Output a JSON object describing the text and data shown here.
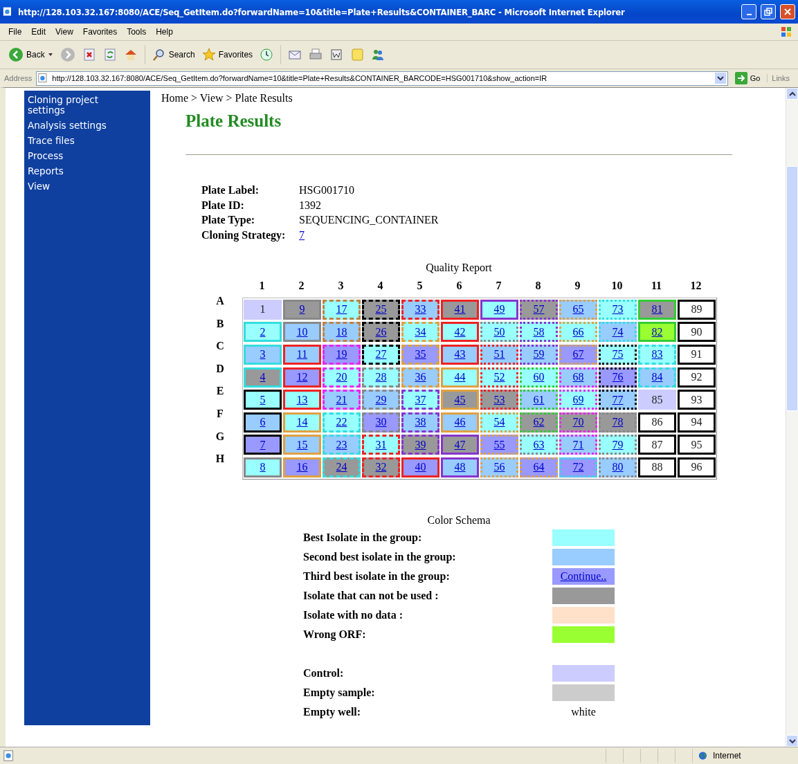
{
  "window": {
    "title": "http://128.103.32.167:8080/ACE/Seq_GetItem.do?forwardName=10&title=Plate+Results&CONTAINER_BARC - Microsoft Internet Explorer"
  },
  "menu": [
    "File",
    "Edit",
    "View",
    "Favorites",
    "Tools",
    "Help"
  ],
  "toolbar": {
    "back": "Back",
    "search": "Search",
    "favorites": "Favorites"
  },
  "address": {
    "label": "Address",
    "value": "http://128.103.32.167:8080/ACE/Seq_GetItem.do?forwardName=10&title=Plate+Results&CONTAINER_BARCODE=HSG001710&show_action=IR",
    "go": "Go",
    "links": "Links"
  },
  "sidebar": {
    "items": [
      "Cloning project settings",
      "Analysis settings",
      "Trace files",
      "Process",
      "Reports",
      "View"
    ]
  },
  "breadcrumb": "Home > View > Plate Results",
  "title": "Plate Results",
  "info": [
    {
      "label": "Plate Label:",
      "value": "HSG001710",
      "link": false
    },
    {
      "label": "Plate ID:",
      "value": "1392",
      "link": false
    },
    {
      "label": "Plate Type:",
      "value": "SEQUENCING_CONTAINER",
      "link": false
    },
    {
      "label": "Cloning Strategy:",
      "value": "7",
      "link": true
    }
  ],
  "plate": {
    "title": "Quality Report",
    "columns": [
      "1",
      "2",
      "3",
      "4",
      "5",
      "6",
      "7",
      "8",
      "9",
      "10",
      "11",
      "12"
    ],
    "rows": [
      {
        "label": "A",
        "wells": [
          {
            "label": "1",
            "link": false,
            "color": "#ccccff"
          },
          {
            "label": "9",
            "link": true,
            "color": "#999999",
            "frame": {
              "kind": "solid",
              "color": "#888888"
            }
          },
          {
            "label": "17",
            "link": true,
            "color": "#99ffff",
            "frame": {
              "kind": "dashed",
              "color": "#c08040"
            }
          },
          {
            "label": "25",
            "link": true,
            "color": "#999999",
            "frame": {
              "kind": "dashed",
              "color": "#000000"
            }
          },
          {
            "label": "33",
            "link": true,
            "color": "#99ccff",
            "frame": {
              "kind": "dashed",
              "color": "#ee2222"
            }
          },
          {
            "label": "41",
            "link": true,
            "color": "#999999",
            "frame": {
              "kind": "solid",
              "color": "#ee2222"
            }
          },
          {
            "label": "49",
            "link": true,
            "color": "#99ffff",
            "frame": {
              "kind": "solid",
              "color": "#8833cc"
            }
          },
          {
            "label": "57",
            "link": true,
            "color": "#999999",
            "frame": {
              "kind": "dotted",
              "color": "#8833cc"
            }
          },
          {
            "label": "65",
            "link": true,
            "color": "#99ccff",
            "frame": {
              "kind": "dotted",
              "color": "#e0a040"
            }
          },
          {
            "label": "73",
            "link": true,
            "color": "#99ffff",
            "frame": {
              "kind": "dotted",
              "color": "#33dddd"
            }
          },
          {
            "label": "81",
            "link": true,
            "color": "#999999",
            "frame": {
              "kind": "solid",
              "color": "#33cc33"
            }
          },
          {
            "label": "89",
            "link": false,
            "color": "#ffffff",
            "frame": {
              "kind": "solid",
              "color": "#000000"
            }
          }
        ]
      },
      {
        "label": "B",
        "wells": [
          {
            "label": "2",
            "link": true,
            "color": "#99ffff",
            "frame": {
              "kind": "solid",
              "color": "#33dddd"
            }
          },
          {
            "label": "10",
            "link": true,
            "color": "#99ccff",
            "frame": {
              "kind": "solid",
              "color": "#888888"
            }
          },
          {
            "label": "18",
            "link": true,
            "color": "#99ccff",
            "frame": {
              "kind": "dashed",
              "color": "#c08040"
            }
          },
          {
            "label": "26",
            "link": true,
            "color": "#999999",
            "frame": {
              "kind": "dashed",
              "color": "#000000"
            }
          },
          {
            "label": "34",
            "link": true,
            "color": "#99ffff",
            "frame": {
              "kind": "dashed",
              "color": "#e0a040"
            }
          },
          {
            "label": "42",
            "link": true,
            "color": "#99ffff",
            "frame": {
              "kind": "solid",
              "color": "#ee2222"
            }
          },
          {
            "label": "50",
            "link": true,
            "color": "#99ffff",
            "frame": {
              "kind": "dotted",
              "color": "#888888"
            }
          },
          {
            "label": "58",
            "link": true,
            "color": "#99ffff",
            "frame": {
              "kind": "dotted",
              "color": "#8833cc"
            }
          },
          {
            "label": "66",
            "link": true,
            "color": "#99ffff",
            "frame": {
              "kind": "dotted",
              "color": "#e0a040"
            }
          },
          {
            "label": "74",
            "link": true,
            "color": "#99ccff",
            "frame": {
              "kind": "dotted",
              "color": "#33dddd"
            }
          },
          {
            "label": "82",
            "link": true,
            "color": "#99ff33",
            "frame": {
              "kind": "solid",
              "color": "#33cc33"
            }
          },
          {
            "label": "90",
            "link": false,
            "color": "#ffffff",
            "frame": {
              "kind": "solid",
              "color": "#000000"
            }
          }
        ]
      },
      {
        "label": "C",
        "wells": [
          {
            "label": "3",
            "link": true,
            "color": "#99ccff",
            "frame": {
              "kind": "solid",
              "color": "#33dddd"
            }
          },
          {
            "label": "11",
            "link": true,
            "color": "#99ccff",
            "frame": {
              "kind": "solid",
              "color": "#ee2222"
            }
          },
          {
            "label": "19",
            "link": true,
            "color": "#9999ff",
            "frame": {
              "kind": "dashed",
              "color": "#ee22ee"
            }
          },
          {
            "label": "27",
            "link": true,
            "color": "#99ffff",
            "frame": {
              "kind": "dashed",
              "color": "#000000"
            }
          },
          {
            "label": "35",
            "link": true,
            "color": "#9999ff",
            "frame": {
              "kind": "dashed",
              "color": "#e0a040"
            }
          },
          {
            "label": "43",
            "link": true,
            "color": "#99ccff",
            "frame": {
              "kind": "solid",
              "color": "#ee2222"
            }
          },
          {
            "label": "51",
            "link": true,
            "color": "#99ccff",
            "frame": {
              "kind": "dotted",
              "color": "#ee2222"
            }
          },
          {
            "label": "59",
            "link": true,
            "color": "#99ccff",
            "frame": {
              "kind": "dotted",
              "color": "#8833cc"
            }
          },
          {
            "label": "67",
            "link": true,
            "color": "#9999ff",
            "frame": {
              "kind": "dotted",
              "color": "#e0a040"
            }
          },
          {
            "label": "75",
            "link": true,
            "color": "#99ffff",
            "frame": {
              "kind": "dotted",
              "color": "#000000"
            }
          },
          {
            "label": "83",
            "link": true,
            "color": "#99ffff",
            "frame": {
              "kind": "dashed",
              "color": "#33dddd"
            }
          },
          {
            "label": "91",
            "link": false,
            "color": "#ffffff",
            "frame": {
              "kind": "solid",
              "color": "#000000"
            }
          }
        ]
      },
      {
        "label": "D",
        "wells": [
          {
            "label": "4",
            "link": true,
            "color": "#999999",
            "frame": {
              "kind": "solid",
              "color": "#33dddd"
            }
          },
          {
            "label": "12",
            "link": true,
            "color": "#9999ff",
            "frame": {
              "kind": "solid",
              "color": "#ee2222"
            }
          },
          {
            "label": "20",
            "link": true,
            "color": "#99ffff",
            "frame": {
              "kind": "dashed",
              "color": "#ee22ee"
            }
          },
          {
            "label": "28",
            "link": true,
            "color": "#99ffff",
            "frame": {
              "kind": "dashed",
              "color": "#888888"
            }
          },
          {
            "label": "36",
            "link": true,
            "color": "#99ccff",
            "frame": {
              "kind": "dashed",
              "color": "#e0a040"
            }
          },
          {
            "label": "44",
            "link": true,
            "color": "#99ffff",
            "frame": {
              "kind": "solid",
              "color": "#e0a040"
            }
          },
          {
            "label": "52",
            "link": true,
            "color": "#99ffff",
            "frame": {
              "kind": "dotted",
              "color": "#ee2222"
            }
          },
          {
            "label": "60",
            "link": true,
            "color": "#99ffff",
            "frame": {
              "kind": "dotted",
              "color": "#33cc33"
            }
          },
          {
            "label": "68",
            "link": true,
            "color": "#99ccff",
            "frame": {
              "kind": "dotted",
              "color": "#ee22ee"
            }
          },
          {
            "label": "76",
            "link": true,
            "color": "#9999ff",
            "frame": {
              "kind": "dotted",
              "color": "#000000"
            }
          },
          {
            "label": "84",
            "link": true,
            "color": "#99ccff",
            "frame": {
              "kind": "dashed",
              "color": "#33dddd"
            }
          },
          {
            "label": "92",
            "link": false,
            "color": "#ffffff",
            "frame": {
              "kind": "solid",
              "color": "#000000"
            }
          }
        ]
      },
      {
        "label": "E",
        "wells": [
          {
            "label": "5",
            "link": true,
            "color": "#99ffff",
            "frame": {
              "kind": "solid",
              "color": "#000000"
            }
          },
          {
            "label": "13",
            "link": true,
            "color": "#99ffff",
            "frame": {
              "kind": "solid",
              "color": "#ee2222"
            }
          },
          {
            "label": "21",
            "link": true,
            "color": "#99ccff",
            "frame": {
              "kind": "dashed",
              "color": "#ee22ee"
            }
          },
          {
            "label": "29",
            "link": true,
            "color": "#99ccff",
            "frame": {
              "kind": "dashed",
              "color": "#888888"
            }
          },
          {
            "label": "37",
            "link": true,
            "color": "#99ffff",
            "frame": {
              "kind": "dashed",
              "color": "#8833cc"
            }
          },
          {
            "label": "45",
            "link": true,
            "color": "#999999",
            "frame": {
              "kind": "solid",
              "color": "#e0a040"
            }
          },
          {
            "label": "53",
            "link": true,
            "color": "#999999",
            "frame": {
              "kind": "dotted",
              "color": "#ee2222"
            }
          },
          {
            "label": "61",
            "link": true,
            "color": "#99ccff",
            "frame": {
              "kind": "dotted",
              "color": "#33cc33"
            }
          },
          {
            "label": "69",
            "link": true,
            "color": "#99ffff",
            "frame": {
              "kind": "dotted",
              "color": "#ee22ee"
            }
          },
          {
            "label": "77",
            "link": true,
            "color": "#99ccff",
            "frame": {
              "kind": "dotted",
              "color": "#000000"
            }
          },
          {
            "label": "85",
            "link": false,
            "color": "#ccccff"
          },
          {
            "label": "93",
            "link": false,
            "color": "#ffffff",
            "frame": {
              "kind": "solid",
              "color": "#000000"
            }
          }
        ]
      },
      {
        "label": "F",
        "wells": [
          {
            "label": "6",
            "link": true,
            "color": "#99ccff",
            "frame": {
              "kind": "solid",
              "color": "#000000"
            }
          },
          {
            "label": "14",
            "link": true,
            "color": "#99ffff",
            "frame": {
              "kind": "solid",
              "color": "#e0a040"
            }
          },
          {
            "label": "22",
            "link": true,
            "color": "#99ffff",
            "frame": {
              "kind": "dashed",
              "color": "#33dddd"
            }
          },
          {
            "label": "30",
            "link": true,
            "color": "#9999ff",
            "frame": {
              "kind": "dashed",
              "color": "#888888"
            }
          },
          {
            "label": "38",
            "link": true,
            "color": "#99ccff",
            "frame": {
              "kind": "dashed",
              "color": "#8833cc"
            }
          },
          {
            "label": "46",
            "link": true,
            "color": "#99ccff",
            "frame": {
              "kind": "solid",
              "color": "#e0a040"
            }
          },
          {
            "label": "54",
            "link": true,
            "color": "#99ffff",
            "frame": {
              "kind": "dotted",
              "color": "#e0a040"
            }
          },
          {
            "label": "62",
            "link": true,
            "color": "#999999",
            "frame": {
              "kind": "dotted",
              "color": "#33cc33"
            }
          },
          {
            "label": "70",
            "link": true,
            "color": "#999999",
            "frame": {
              "kind": "dotted",
              "color": "#ee22ee"
            }
          },
          {
            "label": "78",
            "link": true,
            "color": "#999999",
            "frame": {
              "kind": "dotted",
              "color": "#888888"
            }
          },
          {
            "label": "86",
            "link": false,
            "color": "#ffffff",
            "frame": {
              "kind": "solid",
              "color": "#000000"
            }
          },
          {
            "label": "94",
            "link": false,
            "color": "#ffffff",
            "frame": {
              "kind": "solid",
              "color": "#000000"
            }
          }
        ]
      },
      {
        "label": "G",
        "wells": [
          {
            "label": "7",
            "link": true,
            "color": "#9999ff",
            "frame": {
              "kind": "solid",
              "color": "#000000"
            }
          },
          {
            "label": "15",
            "link": true,
            "color": "#99ccff",
            "frame": {
              "kind": "solid",
              "color": "#e0a040"
            }
          },
          {
            "label": "23",
            "link": true,
            "color": "#99ccff",
            "frame": {
              "kind": "dashed",
              "color": "#33dddd"
            }
          },
          {
            "label": "31",
            "link": true,
            "color": "#99ffff",
            "frame": {
              "kind": "dashed",
              "color": "#ee2222"
            }
          },
          {
            "label": "39",
            "link": true,
            "color": "#999999",
            "frame": {
              "kind": "dashed",
              "color": "#8833cc"
            }
          },
          {
            "label": "47",
            "link": true,
            "color": "#999999",
            "frame": {
              "kind": "solid",
              "color": "#8833cc"
            }
          },
          {
            "label": "55",
            "link": true,
            "color": "#9999ff",
            "frame": {
              "kind": "dotted",
              "color": "#e0a040"
            }
          },
          {
            "label": "63",
            "link": true,
            "color": "#99ffff",
            "frame": {
              "kind": "dotted",
              "color": "#888888"
            }
          },
          {
            "label": "71",
            "link": true,
            "color": "#99ccff",
            "frame": {
              "kind": "dotted",
              "color": "#ee22ee"
            }
          },
          {
            "label": "79",
            "link": true,
            "color": "#99ffff",
            "frame": {
              "kind": "dotted",
              "color": "#888888"
            }
          },
          {
            "label": "87",
            "link": false,
            "color": "#ffffff",
            "frame": {
              "kind": "solid",
              "color": "#000000"
            }
          },
          {
            "label": "95",
            "link": false,
            "color": "#ffffff",
            "frame": {
              "kind": "solid",
              "color": "#000000"
            }
          }
        ]
      },
      {
        "label": "H",
        "wells": [
          {
            "label": "8",
            "link": true,
            "color": "#99ffff",
            "frame": {
              "kind": "solid",
              "color": "#888888"
            }
          },
          {
            "label": "16",
            "link": true,
            "color": "#9999ff",
            "frame": {
              "kind": "solid",
              "color": "#e0a040"
            }
          },
          {
            "label": "24",
            "link": true,
            "color": "#999999",
            "frame": {
              "kind": "dashed",
              "color": "#33dddd"
            }
          },
          {
            "label": "32",
            "link": true,
            "color": "#999999",
            "frame": {
              "kind": "dashed",
              "color": "#ee2222"
            }
          },
          {
            "label": "40",
            "link": true,
            "color": "#9999ff",
            "frame": {
              "kind": "solid",
              "color": "#ee2222"
            }
          },
          {
            "label": "48",
            "link": true,
            "color": "#99ccff",
            "frame": {
              "kind": "solid",
              "color": "#8833cc"
            }
          },
          {
            "label": "56",
            "link": true,
            "color": "#99ccff",
            "frame": {
              "kind": "dotted",
              "color": "#e0a040"
            }
          },
          {
            "label": "64",
            "link": true,
            "color": "#9999ff",
            "frame": {
              "kind": "dotted",
              "color": "#e0a040"
            }
          },
          {
            "label": "72",
            "link": true,
            "color": "#9999ff",
            "frame": {
              "kind": "dotted",
              "color": "#33dddd"
            }
          },
          {
            "label": "80",
            "link": true,
            "color": "#99ccff",
            "frame": {
              "kind": "dotted",
              "color": "#888888"
            }
          },
          {
            "label": "88",
            "link": false,
            "color": "#ffffff",
            "frame": {
              "kind": "solid",
              "color": "#000000"
            }
          },
          {
            "label": "96",
            "link": false,
            "color": "#ffffff",
            "frame": {
              "kind": "solid",
              "color": "#000000"
            }
          }
        ]
      }
    ]
  },
  "schema": {
    "title": "Color Schema",
    "groups": [
      {
        "items": [
          {
            "label": "Best Isolate in the group:",
            "kind": "swatch",
            "color": "#99ffff"
          },
          {
            "label": "Second best isolate in the group:",
            "kind": "swatch",
            "color": "#99ccff"
          },
          {
            "label": "Third best isolate in the group:",
            "kind": "link",
            "color": "#9999ff",
            "value": "Continue.."
          },
          {
            "label": "Isolate that can not be used :",
            "kind": "swatch",
            "color": "#999999"
          },
          {
            "label": "Isolate with no data :",
            "kind": "swatch",
            "color": "#ffe0c8"
          },
          {
            "label": "Wrong ORF:",
            "kind": "swatch",
            "color": "#99ff33"
          }
        ]
      },
      {
        "items": [
          {
            "label": "Control:",
            "kind": "swatch",
            "color": "#ccccff"
          },
          {
            "label": "Empty sample:",
            "kind": "swatch",
            "color": "#cccccc"
          },
          {
            "label": "Empty well:",
            "kind": "text",
            "value": "white"
          }
        ]
      }
    ]
  },
  "status_bar": {
    "zone": "Internet"
  }
}
